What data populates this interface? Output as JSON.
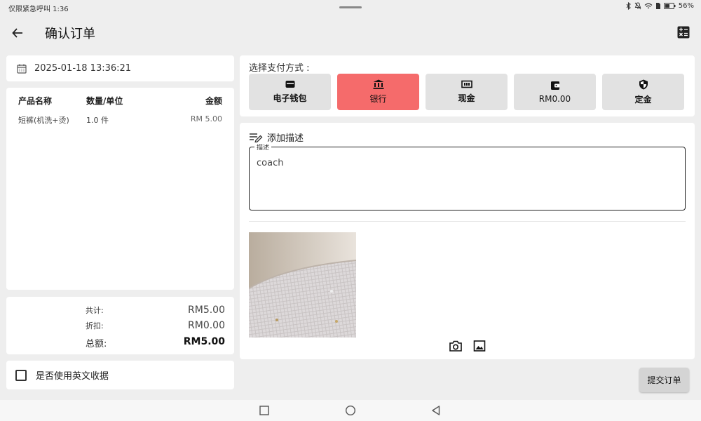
{
  "status_bar": {
    "left_text": "仅限紧急呼叫 1:36",
    "battery": "56%"
  },
  "header": {
    "title": "确认订单"
  },
  "order": {
    "datetime": "2025-01-18 13:36:21",
    "columns": [
      "产品名称",
      "数量/单位",
      "金额"
    ],
    "items": [
      {
        "name": "短裤(机洗+烫)",
        "qty": "1.0 件",
        "amount": "RM 5.00"
      }
    ]
  },
  "totals": {
    "subtotal_label": "共计:",
    "subtotal_value": "RM5.00",
    "discount_label": "折扣:",
    "discount_value": "RM0.00",
    "total_label": "总额:",
    "total_value": "RM5.00"
  },
  "english_receipt": {
    "label": "是否使用英文收据",
    "checked": false
  },
  "payment": {
    "title": "选择支付方式 :",
    "active_color": "#f56b6b",
    "methods": [
      {
        "label": "电子钱包",
        "icon": "wallet-card-icon",
        "active": false
      },
      {
        "label": "银行",
        "icon": "bank-icon",
        "active": true
      },
      {
        "label": "现金",
        "icon": "cash-icon",
        "active": false
      },
      {
        "label": "RM0.00",
        "icon": "account-balance-wallet-icon",
        "active": false
      },
      {
        "label": "定金",
        "icon": "shield-icon",
        "active": false
      }
    ]
  },
  "description": {
    "header": "添加描述",
    "legend": "描述",
    "value": "coach"
  },
  "actions": {
    "submit_label": "提交订单"
  }
}
